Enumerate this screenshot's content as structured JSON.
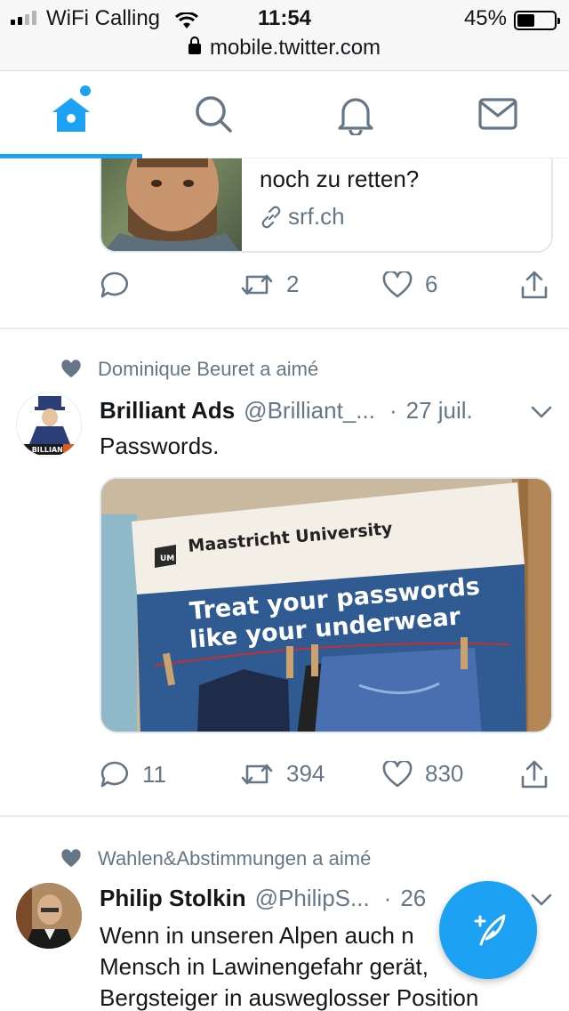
{
  "status_bar": {
    "carrier": "WiFi Calling",
    "time": "11:54",
    "battery_percent": "45%",
    "battery_level": 0.45
  },
  "browser": {
    "url": "mobile.twitter.com"
  },
  "nav": {
    "items": [
      "home-icon",
      "search-icon",
      "bell-icon",
      "mail-icon"
    ],
    "active": "home",
    "accent_color": "#1da1f2"
  },
  "tweet1": {
    "card_text": "noch zu retten?",
    "card_domain": "srf.ch",
    "replies": "",
    "retweets": "2",
    "likes": "6"
  },
  "tweet2": {
    "social_context": "Dominique Beuret a aimé",
    "name": "Brilliant Ads",
    "handle": "@Brilliant_...",
    "time": "27 juil.",
    "avatar_text": "BILLIANT",
    "text": "Passwords.",
    "photo": {
      "logo_text": "Maastricht University",
      "logo_mark": "UM",
      "line1": "Treat your passwords",
      "line2": "like your underwear"
    },
    "replies": "11",
    "retweets": "394",
    "likes": "830"
  },
  "tweet3": {
    "social_context": "Wahlen&Abstimmungen a aimé",
    "name": "Philip Stolkin",
    "handle": "@PhilipS...",
    "time": "26",
    "text_lines": [
      "Wenn in unseren Alpen auch n",
      "Mensch in Lawinengefahr gerät,",
      "Bergsteiger in ausweglosser Position"
    ]
  },
  "colors": {
    "accent": "#1da1f2",
    "secondary_text": "#657786",
    "primary_text": "#14171a",
    "divider": "#e6ecf0"
  }
}
